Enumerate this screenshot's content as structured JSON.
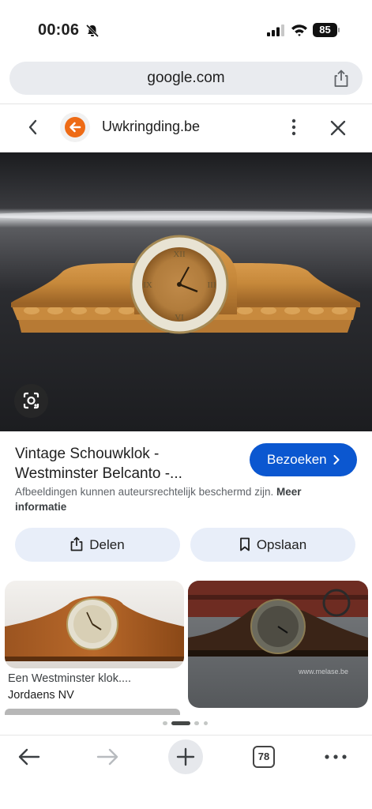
{
  "status_bar": {
    "time": "00:06",
    "battery": "85"
  },
  "browser": {
    "url": "google.com",
    "open_tabs": "78"
  },
  "header": {
    "site_name": "Uwkringding.be"
  },
  "result": {
    "title_line1": "Vintage Schouwklok -",
    "title_line2": "Westminster Belcanto -...",
    "visit_label": "Bezoeken",
    "copyright_text": "Afbeeldingen kunnen auteursrechtelijk beschermd zijn.",
    "more_info_label": "Meer informatie",
    "share_label": "Delen",
    "save_label": "Opslaan"
  },
  "related": [
    {
      "caption": "Een Westminster klok....",
      "source": "Jordaens NV"
    },
    {
      "watermark": "www.melase.be"
    }
  ],
  "icons": [
    "bell-muted-icon",
    "signal-icon",
    "wifi-icon",
    "share-icon",
    "back-chevron-icon",
    "favicon-icon",
    "more-vert-icon",
    "close-icon",
    "lens-icon",
    "chevron-right-icon",
    "bookmark-icon",
    "back-arrow-icon",
    "forward-arrow-icon",
    "plus-icon",
    "more-horiz-icon"
  ],
  "colors": {
    "accent_blue": "#0b57d0",
    "pill_bg": "#e8eef9",
    "favicon_orange": "#ee6b16"
  }
}
